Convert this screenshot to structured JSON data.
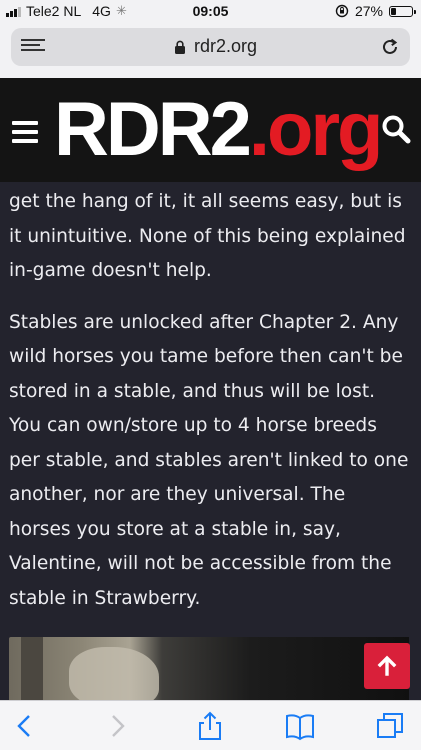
{
  "status_bar": {
    "carrier": "Tele2 NL",
    "network": "4G",
    "time": "09:05",
    "battery_text": "27%",
    "battery_level": 0.27
  },
  "browser": {
    "url": "rdr2.org"
  },
  "site": {
    "logo_main": "RDR2",
    "logo_dot": ".",
    "logo_tld": "org",
    "logo_color": "#e31b23"
  },
  "article": {
    "paragraph_1": "get the hang of it, it all seems easy, but is it unintuitive. None of this being explained in-game doesn't help.",
    "paragraph_2": "Stables are unlocked after Chapter 2. Any wild horses you tame before then can't be stored in a stable, and thus will be lost. You can own/store up to 4 horse breeds per stable, and stables aren't linked to one another, nor are they universal. The horses you store at a stable in, say, Valentine, will not be accessible from the stable in Strawberry."
  },
  "icons": {
    "reader": "reader-view-icon",
    "lock": "lock-icon",
    "reload": "reload-icon",
    "menu": "hamburger-icon",
    "search": "search-icon",
    "scroll_top": "arrow-up-icon",
    "back": "back-chevron-icon",
    "forward": "forward-chevron-icon",
    "share": "share-icon",
    "bookmarks": "bookmarks-icon",
    "tabs": "tabs-icon"
  },
  "colors": {
    "background": "#23232d",
    "accent": "#d9203a",
    "ios_blue": "#1a7cf5"
  }
}
